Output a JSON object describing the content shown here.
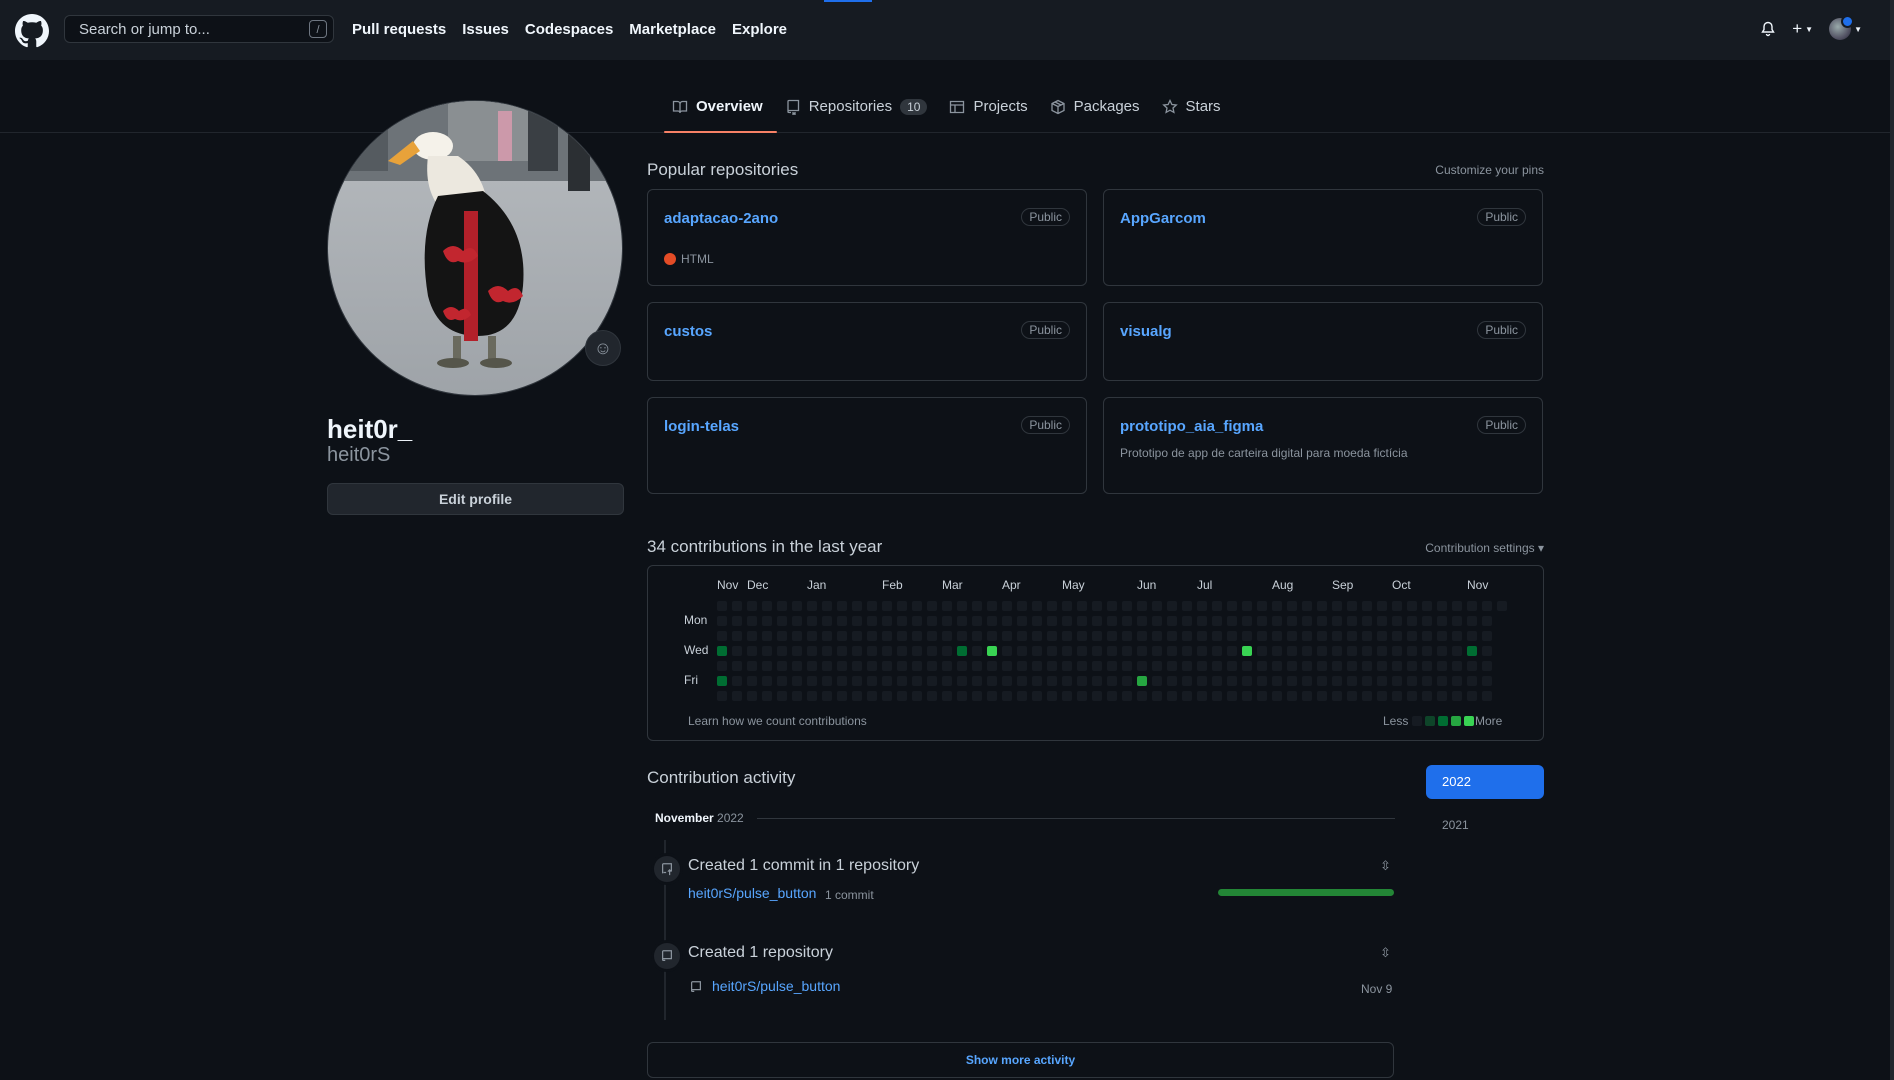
{
  "header": {
    "search_placeholder": "Search or jump to...",
    "search_shortcut": "/",
    "nav": [
      "Pull requests",
      "Issues",
      "Codespaces",
      "Marketplace",
      "Explore"
    ],
    "plus": "+"
  },
  "tabs": [
    {
      "label": "Overview",
      "icon": "book-icon",
      "active": true
    },
    {
      "label": "Repositories",
      "icon": "repo-icon",
      "count": "10"
    },
    {
      "label": "Projects",
      "icon": "table-icon"
    },
    {
      "label": "Packages",
      "icon": "package-icon"
    },
    {
      "label": "Stars",
      "icon": "star-icon"
    }
  ],
  "profile": {
    "name": "heit0r_",
    "login": "heit0rS",
    "edit_label": "Edit profile"
  },
  "popular": {
    "title": "Popular repositories",
    "customize": "Customize your pins",
    "repos": [
      {
        "name": "adaptacao-2ano",
        "badge": "Public",
        "lang": "HTML",
        "lang_color": "#e34c26"
      },
      {
        "name": "AppGarcom",
        "badge": "Public"
      },
      {
        "name": "custos",
        "badge": "Public"
      },
      {
        "name": "visualg",
        "badge": "Public"
      },
      {
        "name": "login-telas",
        "badge": "Public"
      },
      {
        "name": "prototipo_aia_figma",
        "badge": "Public",
        "desc": "Prototipo de app de carteira digital para moeda fictícia"
      }
    ]
  },
  "contributions": {
    "title": "34 contributions in the last year",
    "settings": "Contribution settings ▾",
    "months": [
      "Nov",
      "Dec",
      "Jan",
      "Feb",
      "Mar",
      "Apr",
      "May",
      "Jun",
      "Jul",
      "Aug",
      "Sep",
      "Oct",
      "Nov"
    ],
    "days": [
      "Mon",
      "Wed",
      "Fri"
    ],
    "learn": "Learn how we count contributions",
    "less": "Less",
    "more": "More",
    "colors": [
      "#161b22",
      "#0e4429",
      "#006d32",
      "#26a641",
      "#39d353"
    ],
    "active_cells": [
      {
        "week": 0,
        "day": 3,
        "level": 2
      },
      {
        "week": 0,
        "day": 5,
        "level": 2
      },
      {
        "week": 16,
        "day": 3,
        "level": 2
      },
      {
        "week": 18,
        "day": 3,
        "level": 4
      },
      {
        "week": 28,
        "day": 5,
        "level": 3
      },
      {
        "week": 35,
        "day": 3,
        "level": 4
      },
      {
        "week": 50,
        "day": 3,
        "level": 2
      }
    ]
  },
  "activity": {
    "title": "Contribution activity",
    "month": "November",
    "year": "2022",
    "years": [
      "2022",
      "2021"
    ],
    "commit_title": "Created 1 commit in 1 repository",
    "commit_repo": "heit0rS/pulse_button",
    "commit_count": "1 commit",
    "repo_title": "Created 1 repository",
    "repo_name": "heit0rS/pulse_button",
    "repo_date": "Nov 9",
    "show_more": "Show more activity"
  }
}
